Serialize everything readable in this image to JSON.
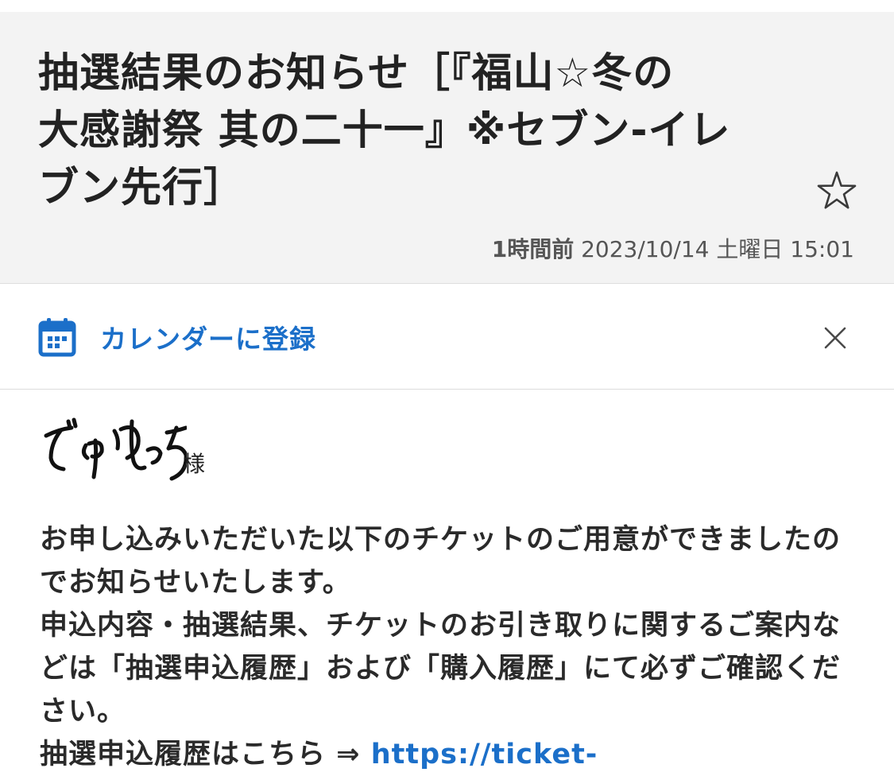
{
  "header": {
    "subject_lines": [
      "抽選結果のお知らせ［『福山☆冬の",
      "大感謝祭 其の二十一』※セブン-イレ",
      "ブン先行］"
    ],
    "relative_time": "1時間前",
    "datetime": "2023/10/14 土曜日 15:01",
    "star_icon": "star-outline-icon"
  },
  "calendar_bar": {
    "label": "カレンダーに登録",
    "icon": "calendar-icon",
    "close_icon": "close-icon"
  },
  "body": {
    "recipient_name": "でゅゆっち",
    "honorific": "様",
    "paragraph_1": "お申し込みいただいた以下のチケットのご用意ができましたのでお知らせいたします。",
    "paragraph_2": "申込内容・抽選結果、チケットのお引き取りに関するご案内などは「抽選申込履歴」および「購入履歴」にて必ずご確認ください。",
    "history_prefix": "抽選申込履歴はこちら ⇒ ",
    "history_link": "https://ticket-"
  },
  "colors": {
    "accent": "#1b6fc9",
    "header_bg": "#f3f3f3",
    "text": "#222222",
    "muted": "#555555"
  }
}
